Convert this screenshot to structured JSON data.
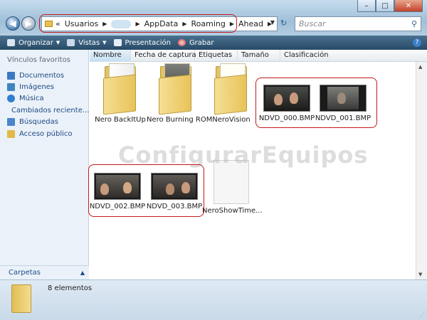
{
  "window": {
    "controls": {
      "minimize": "–",
      "maximize": "□",
      "close": "✕"
    }
  },
  "nav": {
    "back_icon": "back-arrow",
    "forward_icon": "forward-arrow"
  },
  "address": {
    "prefix": "«",
    "crumbs": [
      "Usuarios",
      "AppData",
      "Roaming",
      "Ahead"
    ],
    "refresh": "↻"
  },
  "search": {
    "placeholder": "Buscar"
  },
  "toolbar": {
    "organizar": "Organizar",
    "vistas": "Vistas",
    "presentacion": "Presentación",
    "grabar": "Grabar",
    "help": "?"
  },
  "sidebar": {
    "heading": "Vínculos favoritos",
    "items": [
      {
        "label": "Documentos",
        "color": "#3b78c4"
      },
      {
        "label": "Imágenes",
        "color": "#3f86c0"
      },
      {
        "label": "Música",
        "color": "#2e7fcf"
      },
      {
        "label": "Cambiados reciente...",
        "color": "#4b84bc"
      },
      {
        "label": "Búsquedas",
        "color": "#4a86c8"
      },
      {
        "label": "Acceso público",
        "color": "#e2b94a"
      }
    ],
    "carpetas": "Carpetas"
  },
  "columns": [
    "Nombre",
    "Fecha de captura",
    "Etiquetas",
    "Tamaño",
    "Clasificación"
  ],
  "files": [
    {
      "name": "Nero BackItUp",
      "kind": "folder"
    },
    {
      "name": "Nero Burning ROM",
      "kind": "folder"
    },
    {
      "name": "NeroVision",
      "kind": "folder"
    },
    {
      "name": "NDVD_000.BMP",
      "kind": "image"
    },
    {
      "name": "NDVD_001.BMP",
      "kind": "image"
    },
    {
      "name": "NDVD_002.BMP",
      "kind": "image"
    },
    {
      "name": "NDVD_003.BMP",
      "kind": "image"
    },
    {
      "name": "NeroShowTime...",
      "kind": "document"
    }
  ],
  "watermark": "ConfigurarEquipos",
  "status": {
    "count": "8 elementos"
  },
  "colors": {
    "annotation": "#c41a1a",
    "toolbar": "#274a66",
    "link": "#1f4a85"
  }
}
